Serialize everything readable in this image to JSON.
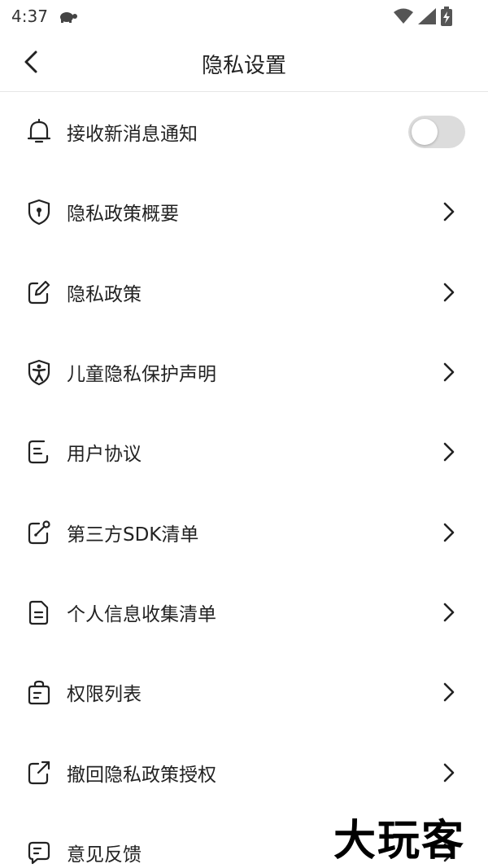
{
  "status_bar": {
    "time": "4:37",
    "icons": [
      "turtle-icon",
      "wifi-icon",
      "signal-icon",
      "battery-charging-icon"
    ]
  },
  "header": {
    "title": "隐私设置",
    "back_icon": "chevron-left-icon"
  },
  "notification": {
    "label": "接收新消息通知",
    "icon": "bell-icon",
    "enabled": false
  },
  "menu": [
    {
      "label": "隐私政策概要",
      "icon": "shield-lock-icon"
    },
    {
      "label": "隐私政策",
      "icon": "edit-icon"
    },
    {
      "label": "儿童隐私保护声明",
      "icon": "child-shield-icon"
    },
    {
      "label": "用户协议",
      "icon": "document-icon"
    },
    {
      "label": "第三方SDK清单",
      "icon": "link-edit-icon"
    },
    {
      "label": "个人信息收集清单",
      "icon": "file-icon"
    },
    {
      "label": "权限列表",
      "icon": "bag-icon"
    },
    {
      "label": "撤回隐私政策授权",
      "icon": "external-link-icon"
    },
    {
      "label": "意见反馈",
      "icon": "message-icon"
    }
  ],
  "watermark": "大玩客",
  "colors": {
    "text": "#222222",
    "divider": "#e6e6e6",
    "toggle_off": "#dcdcdc"
  }
}
